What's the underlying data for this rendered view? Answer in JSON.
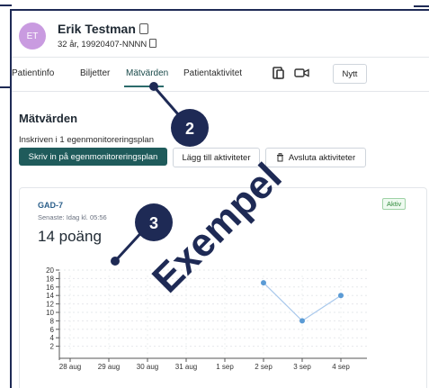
{
  "patient": {
    "initials": "ET",
    "name": "Erik Testman",
    "details": "32 år, 19920407-NNNN"
  },
  "tabs": [
    {
      "label": "Patientinfo"
    },
    {
      "label": "Biljetter"
    },
    {
      "label": "Mätvärden",
      "active": true
    },
    {
      "label": "Patientaktivitet"
    }
  ],
  "toolbar": {
    "new_label": "Nytt",
    "icons": [
      "document-icon",
      "video-call-icon"
    ]
  },
  "section": {
    "title": "Mätvärden",
    "enrolled_text": "Inskriven i 1 egenmonitoreringsplan",
    "primary_button": "Skriv in på egenmonitoreringsplan",
    "add_button": "Lägg till aktiviteter",
    "end_button": "Avsluta aktiviteter"
  },
  "card": {
    "title": "GAD-7",
    "subtitle": "Senaste: Idag kl. 05:56",
    "value": "14 poäng",
    "status": "Aktiv"
  },
  "chart_data": {
    "type": "line",
    "x_ticks": [
      "28 aug",
      "29 aug",
      "30 aug",
      "31 aug",
      "1 sep",
      "2 sep",
      "3 sep",
      "4 sep"
    ],
    "y_ticks": [
      "2",
      "4",
      "6",
      "8",
      "10",
      "12",
      "14",
      "16",
      "18",
      "20"
    ],
    "ylim": [
      0,
      20
    ],
    "series": [
      {
        "x": [
          "2 sep",
          "3 sep",
          "4 sep"
        ],
        "values": [
          17,
          8,
          14
        ]
      }
    ],
    "grid": true,
    "color": "#5b9bd5"
  },
  "annotations": {
    "callout_2": "2",
    "callout_3": "3",
    "watermark": "Exempel"
  },
  "colors": {
    "accent": "#1f5b5b",
    "callout": "#1e2a55",
    "avatar": "#c99be0"
  }
}
